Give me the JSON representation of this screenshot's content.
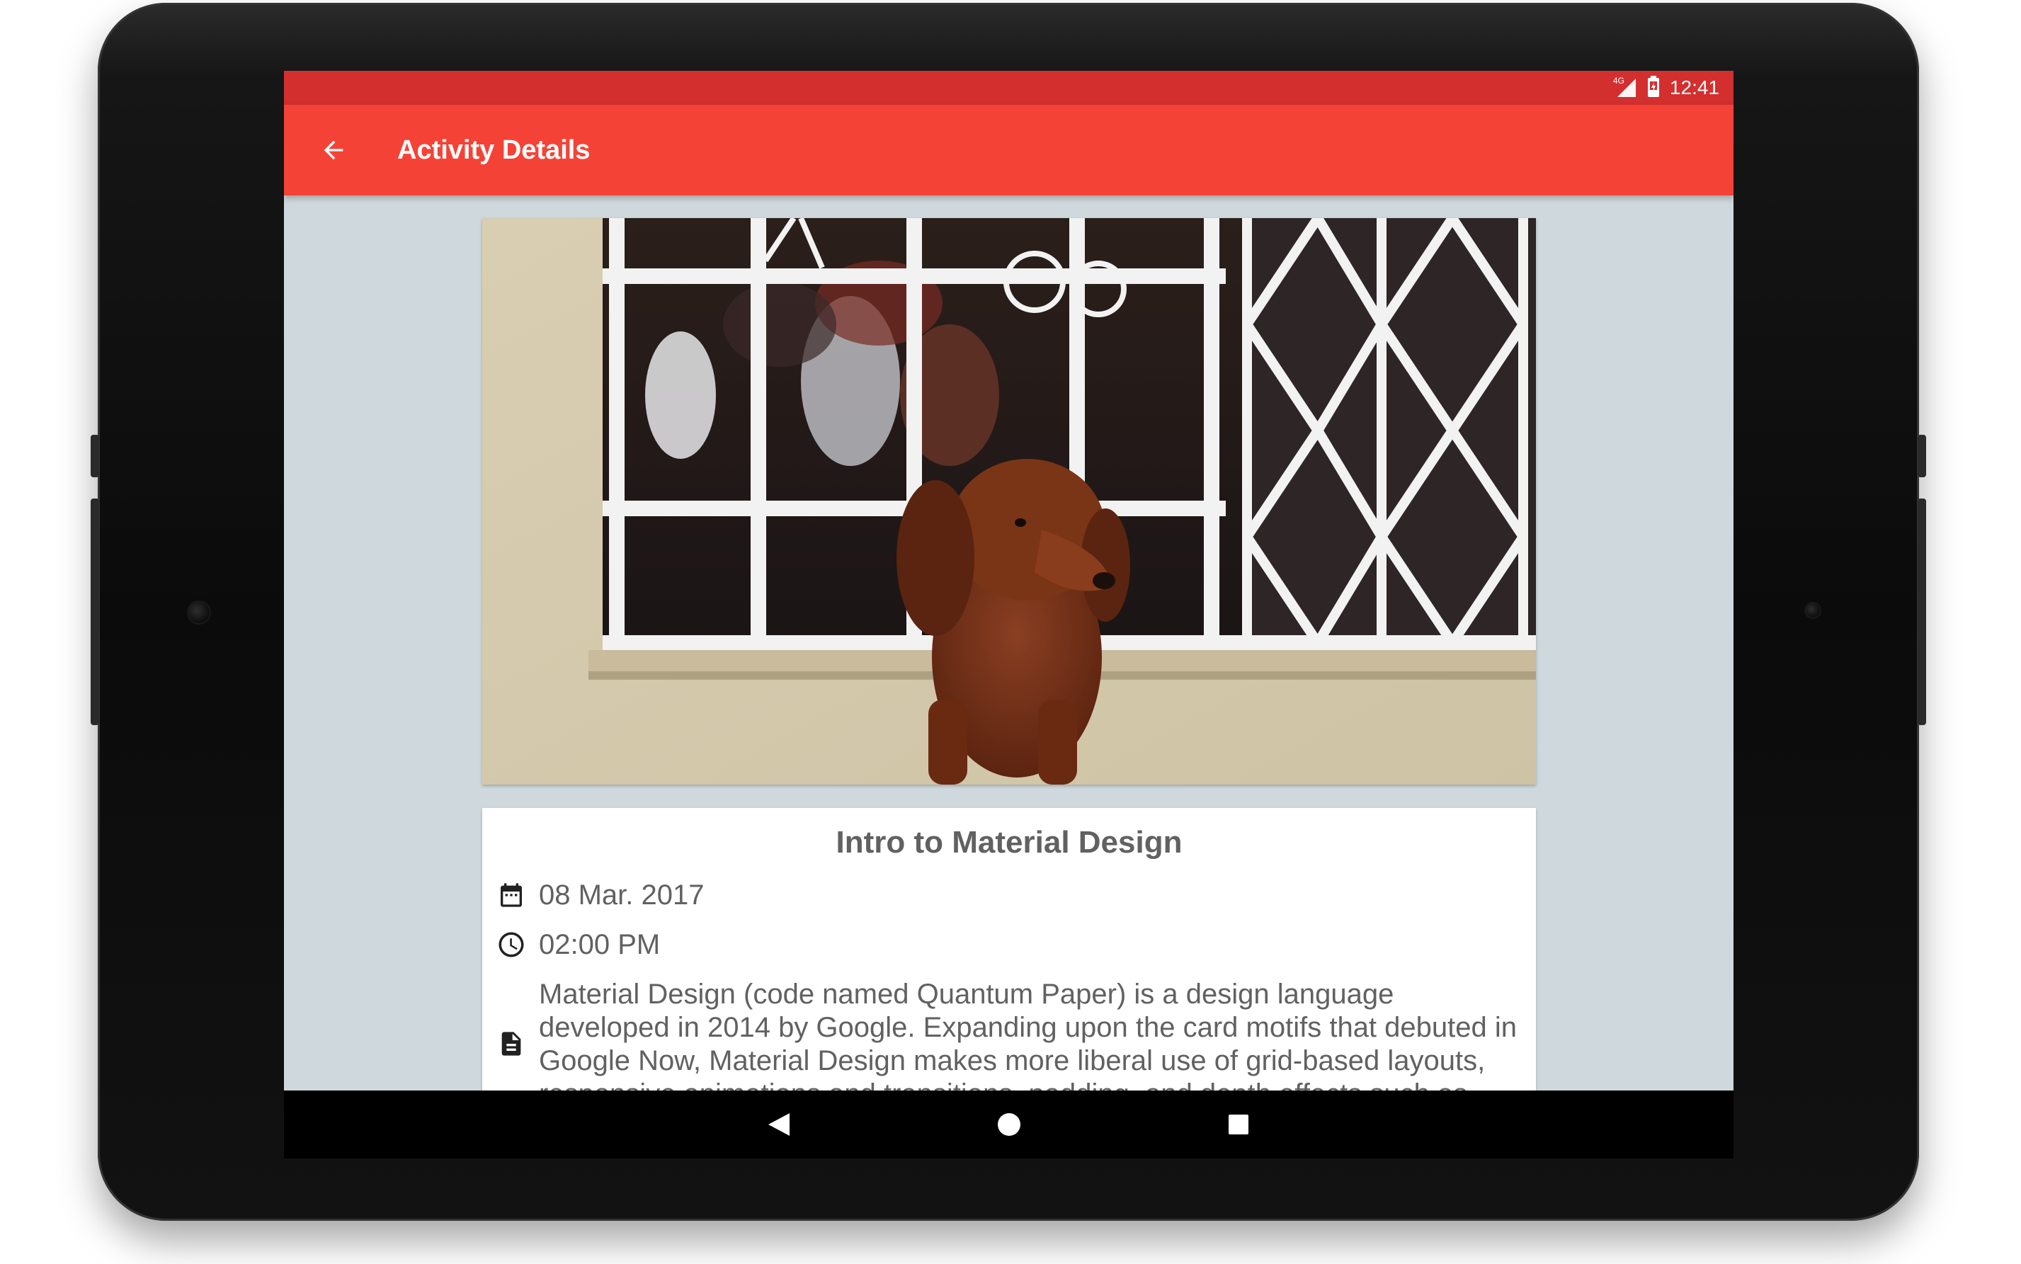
{
  "status_bar": {
    "network": "4G",
    "time": "12:41"
  },
  "app_bar": {
    "title": "Activity Details",
    "back_icon": "arrow-back-icon"
  },
  "activity": {
    "title": "Intro to Material Design",
    "date": "08 Mar. 2017",
    "time": "02:00 PM",
    "description": "Material Design (code named Quantum Paper) is a design language developed in 2014 by Google. Expanding upon the card motifs that debuted in Google Now, Material Design makes more liberal use of grid-based layouts, responsive animations and transitions, padding, and depth effects such as",
    "icons": {
      "date": "calendar-icon",
      "time": "clock-icon",
      "description": "document-icon"
    }
  },
  "nav_bar": {
    "icons": [
      "back-triangle-icon",
      "home-circle-icon",
      "recents-square-icon"
    ]
  },
  "colors": {
    "status_bar": "#d32f2f",
    "app_bar": "#f44336",
    "background": "#cfd8dc",
    "text": "#616161"
  }
}
